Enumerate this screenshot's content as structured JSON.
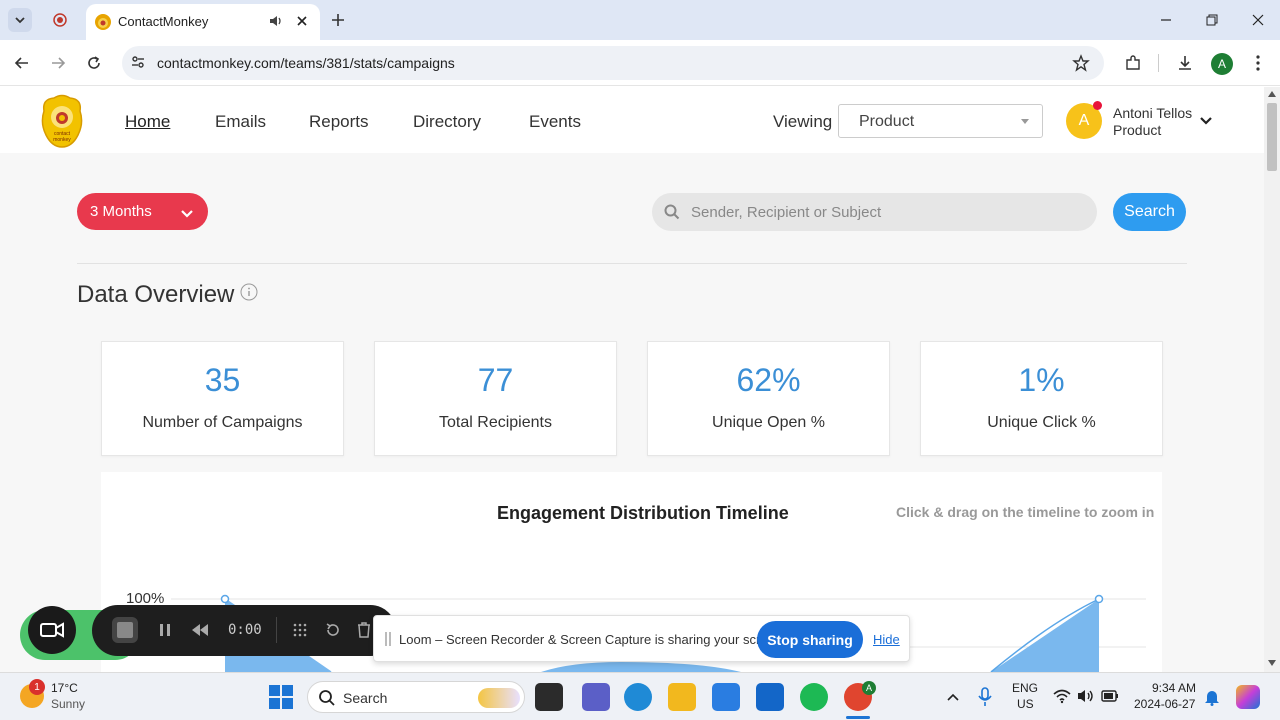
{
  "browser": {
    "tab_title": "ContactMonkey",
    "url": "contactmonkey.com/teams/381/stats/campaigns",
    "profile_initial": "A"
  },
  "header": {
    "logo_text": "contact monkey",
    "nav": [
      "Home",
      "Emails",
      "Reports",
      "Directory",
      "Events"
    ],
    "viewing_label": "Viewing",
    "viewing_value": "Product",
    "user_initial": "A",
    "user_name": "Antoni Tellos",
    "user_team": "Product"
  },
  "filters": {
    "range_label": "3 Months",
    "search_placeholder": "Sender, Recipient or Subject",
    "search_button": "Search"
  },
  "overview": {
    "title": "Data Overview",
    "cards": [
      {
        "value": "35",
        "label": "Number of Campaigns"
      },
      {
        "value": "77",
        "label": "Total Recipients"
      },
      {
        "value": "62%",
        "label": "Unique Open %"
      },
      {
        "value": "1%",
        "label": "Unique Click %"
      }
    ]
  },
  "timeline": {
    "title": "Engagement Distribution Timeline",
    "hint": "Click & drag on the timeline to zoom in",
    "y_tick_top": "100%"
  },
  "loom": {
    "timer": "0:00",
    "sharing_text": "Loom – Screen Recorder & Screen Capture is sharing your screen.",
    "stop_label": "Stop sharing",
    "hide_label": "Hide"
  },
  "taskbar": {
    "weather_temp": "17°C",
    "weather_cond": "Sunny",
    "weather_badge": "1",
    "search_label": "Search",
    "lang_top": "ENG",
    "lang_bottom": "US",
    "time": "9:34 AM",
    "date": "2024-06-27",
    "chrome_badge": "A"
  },
  "colors": {
    "accent_blue": "#3b8fd6",
    "range_red": "#e8394d",
    "search_blue": "#2e9cf0",
    "stop_blue": "#1a6ed8"
  }
}
